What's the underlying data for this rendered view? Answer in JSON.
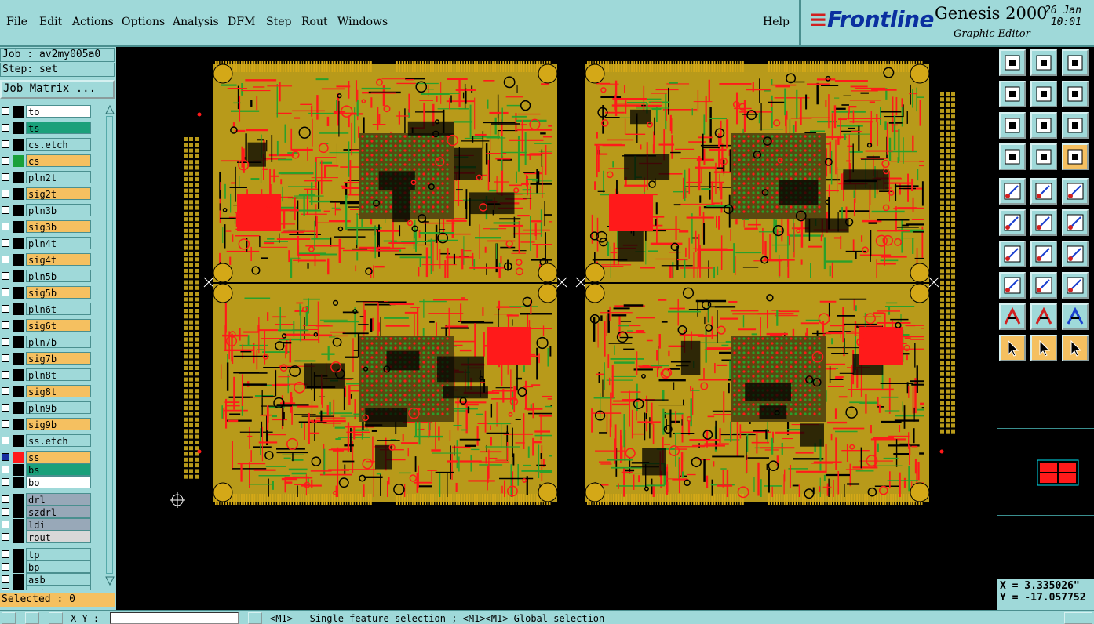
{
  "menu": [
    "File",
    "Edit",
    "Actions",
    "Options",
    "Analysis",
    "DFM",
    "Step",
    "Rout",
    "Windows"
  ],
  "help_label": "Help",
  "brand": {
    "logo_text": "Frontline",
    "product": "Genesis 2000",
    "subtitle": "Graphic Editor",
    "date": "26 Jan",
    "time": "10:01"
  },
  "job": {
    "job_line": "Job : av2my005a0",
    "step_line": "Step: set",
    "job_matrix_label": "Job Matrix ..."
  },
  "layers": [
    {
      "name": "to",
      "color": "#ffffff",
      "swatch": ""
    },
    {
      "name": "ts",
      "color": "#1aa07a",
      "swatch": ""
    },
    {
      "name": "cs.etch",
      "color": "#9fd9d9",
      "swatch": ""
    },
    {
      "name": "cs",
      "color": "#f5c060",
      "swatch": "#1aa03a"
    },
    {
      "name": "pln2t",
      "color": "#9fd9d9",
      "swatch": ""
    },
    {
      "name": "sig2t",
      "color": "#f5c060",
      "swatch": ""
    },
    {
      "name": "pln3b",
      "color": "#9fd9d9",
      "swatch": ""
    },
    {
      "name": "sig3b",
      "color": "#f5c060",
      "swatch": ""
    },
    {
      "name": "pln4t",
      "color": "#9fd9d9",
      "swatch": ""
    },
    {
      "name": "sig4t",
      "color": "#f5c060",
      "swatch": ""
    },
    {
      "name": "pln5b",
      "color": "#9fd9d9",
      "swatch": ""
    },
    {
      "name": "sig5b",
      "color": "#f5c060",
      "swatch": ""
    },
    {
      "name": "pln6t",
      "color": "#9fd9d9",
      "swatch": ""
    },
    {
      "name": "sig6t",
      "color": "#f5c060",
      "swatch": ""
    },
    {
      "name": "pln7b",
      "color": "#9fd9d9",
      "swatch": ""
    },
    {
      "name": "sig7b",
      "color": "#f5c060",
      "swatch": ""
    },
    {
      "name": "pln8t",
      "color": "#9fd9d9",
      "swatch": ""
    },
    {
      "name": "sig8t",
      "color": "#f5c060",
      "swatch": ""
    },
    {
      "name": "pln9b",
      "color": "#9fd9d9",
      "swatch": ""
    },
    {
      "name": "sig9b",
      "color": "#f5c060",
      "swatch": ""
    },
    {
      "name": "ss.etch",
      "color": "#9fd9d9",
      "swatch": ""
    },
    {
      "name": "ss",
      "color": "#f5c060",
      "swatch": "#ff1a1a",
      "active": true
    },
    {
      "name": "bs",
      "color": "#1aa07a",
      "swatch": ""
    },
    {
      "name": "bo",
      "color": "#ffffff",
      "swatch": ""
    },
    {
      "name": "drl",
      "color": "#98a8b8",
      "swatch": ""
    },
    {
      "name": "szdrl",
      "color": "#98a8b8",
      "swatch": ""
    },
    {
      "name": "ldi",
      "color": "#98a8b8",
      "swatch": ""
    },
    {
      "name": "rout",
      "color": "#d8d8d8",
      "swatch": ""
    },
    {
      "name": "tp",
      "color": "#9fd9d9",
      "swatch": ""
    },
    {
      "name": "bp",
      "color": "#9fd9d9",
      "swatch": ""
    },
    {
      "name": "asb",
      "color": "#9fd9d9",
      "swatch": ""
    },
    {
      "name": "ast",
      "color": "#9fd9d9",
      "swatch": ""
    }
  ],
  "selected_label": "Selected : 0",
  "coordinates": {
    "x_line": "X = 3.335026\"",
    "y_line": "Y = -17.057752"
  },
  "bottom": {
    "xy_label": "X Y :",
    "message": "<M1> - Single feature selection ; <M1><M1> Global selection"
  },
  "tools": [
    "zoom-home-icon",
    "zoom-page-icon",
    "zoom-step-icon",
    "pan-left-icon",
    "pan-right-icon",
    "zoom-back-icon",
    "zoom-fit-icon",
    "zoom-center-icon",
    "zoom-1to1-icon",
    "snap-settings-icon",
    "measure-probe-icon",
    "graphic-control-icon",
    "add-pad-icon",
    "add-polygon-icon",
    "ruler-icon",
    "connect-icon",
    "delete-icon",
    "move-point-icon",
    "line-draw-icon",
    "line-slope-icon",
    "arc-icon",
    "move-feature-icon",
    "cut-line-icon",
    "resize-icon",
    "text-a-icon",
    "text-a-red-icon",
    "text-a-blue-icon",
    "select-pointer-icon",
    "select-pointer-orange-icon",
    "select-pointer-yellow-icon"
  ],
  "colors": {
    "panel": "#9fd9d9",
    "board_base": "#b89a1a",
    "trace_red": "#ff1a1a",
    "trace_green": "#2aa02a",
    "selected_tool": "#f5c060"
  }
}
